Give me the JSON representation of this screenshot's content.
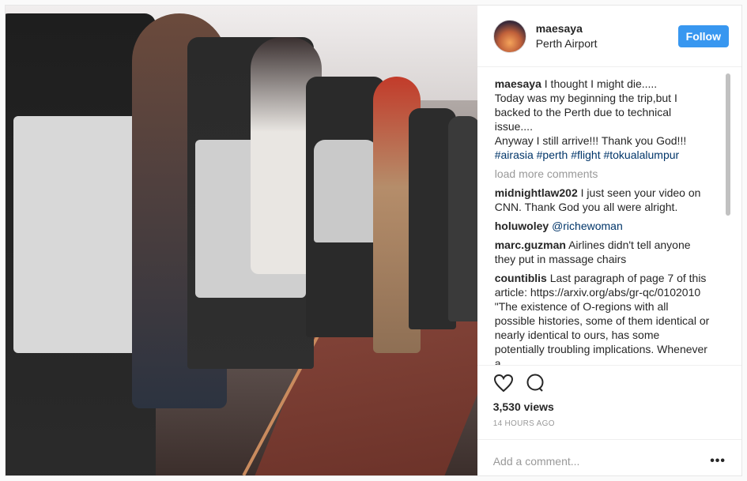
{
  "post": {
    "username": "maesaya",
    "location": "Perth Airport",
    "follow_label": "Follow",
    "caption": {
      "user": "maesaya",
      "lines": [
        "I thought I might die.....",
        "Today was my beginning the trip,but I backed to the Perth due to technical issue....",
        "Anyway I still arrive!!! Thank you God!!!"
      ],
      "hashtags": "#airasia #perth #flight #tokualalumpur"
    },
    "load_more": "load more comments",
    "comments": [
      {
        "user": "midnightlaw202",
        "text": "I just seen your video on CNN. Thank God you all were alright."
      },
      {
        "user": "holuwoley",
        "text": "@richewoman"
      },
      {
        "user": "marc.guzman",
        "text": "Airlines didn't tell anyone they put in massage chairs"
      },
      {
        "user": "countiblis",
        "text": "Last paragraph of page 7 of this article: https://arxiv.org/abs/gr-qc/0102010 \"The existence of O-regions with all possible histories, some of them identical or nearly identical to ours, has some potentially troubling implications. Whenever a"
      }
    ],
    "views": "3,530 views",
    "time": "14 HOURS AGO",
    "add_comment": "Add a comment...",
    "more": "•••",
    "icons": [
      "heart-icon",
      "comment-icon"
    ]
  }
}
